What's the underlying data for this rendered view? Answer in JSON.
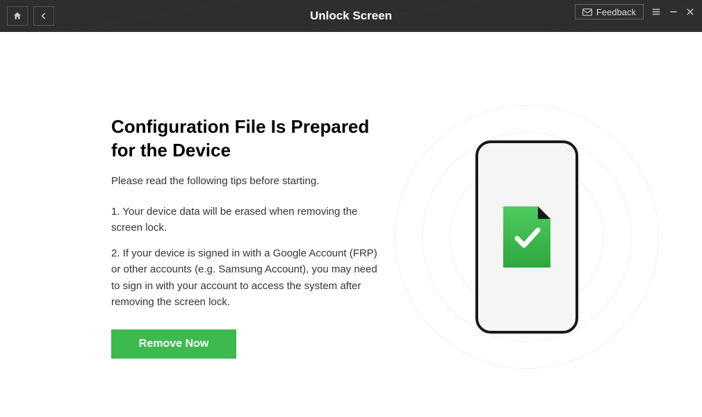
{
  "titlebar": {
    "title": "Unlock Screen",
    "feedback_label": "Feedback"
  },
  "main": {
    "heading": "Configuration File Is Prepared for the Device",
    "subheading": "Please read the following tips before starting.",
    "tip1": "1. Your device data will be erased when removing the screen lock.",
    "tip2": "2. If your device is signed in with a Google Account (FRP) or other accounts (e.g. Samsung Account), you may need to sign in with your account to access the system after removing the screen lock.",
    "cta_label": "Remove Now"
  },
  "colors": {
    "accent": "#3dba4e",
    "titlebar_bg": "#2e2e2e"
  }
}
